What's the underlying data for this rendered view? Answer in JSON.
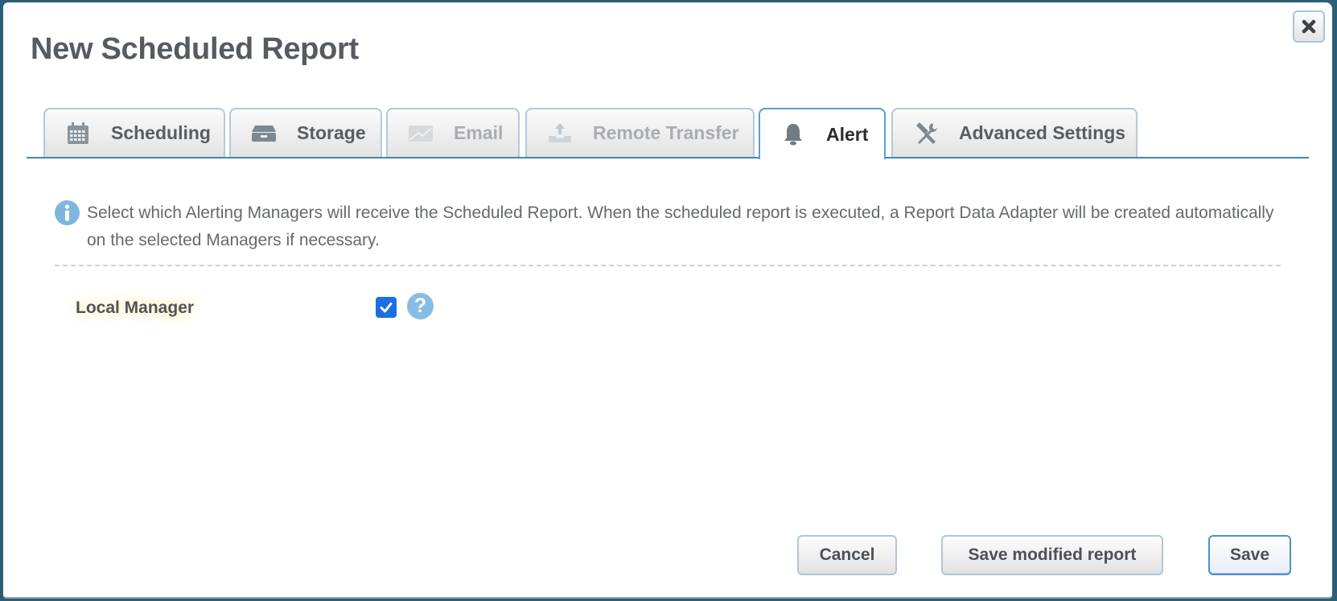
{
  "dialog": {
    "title": "New Scheduled Report",
    "close_icon": "close-icon"
  },
  "tabs": [
    {
      "label": "Scheduling",
      "icon": "calendar-icon",
      "state": "normal"
    },
    {
      "label": "Storage",
      "icon": "drawer-icon",
      "state": "normal"
    },
    {
      "label": "Email",
      "icon": "envelope-icon",
      "state": "disabled"
    },
    {
      "label": "Remote Transfer",
      "icon": "upload-tray-icon",
      "state": "disabled"
    },
    {
      "label": "Alert",
      "icon": "bell-icon",
      "state": "active"
    },
    {
      "label": "Advanced Settings",
      "icon": "tools-icon",
      "state": "normal"
    }
  ],
  "alert_panel": {
    "info_text": "Select which Alerting Managers will receive the Scheduled Report. When the scheduled report is executed, a Report Data Adapter will be created automatically on the selected Managers if necessary.",
    "fields": [
      {
        "label": "Local Manager",
        "checked": true,
        "help_icon": "help-icon"
      }
    ]
  },
  "footer": {
    "cancel_label": "Cancel",
    "save_modified_label": "Save modified report",
    "save_label": "Save"
  },
  "colors": {
    "accent": "#3f8aa8",
    "checkbox": "#1b6ee3",
    "help_icon": "#86bde4",
    "backdrop": "#2b5f75"
  }
}
